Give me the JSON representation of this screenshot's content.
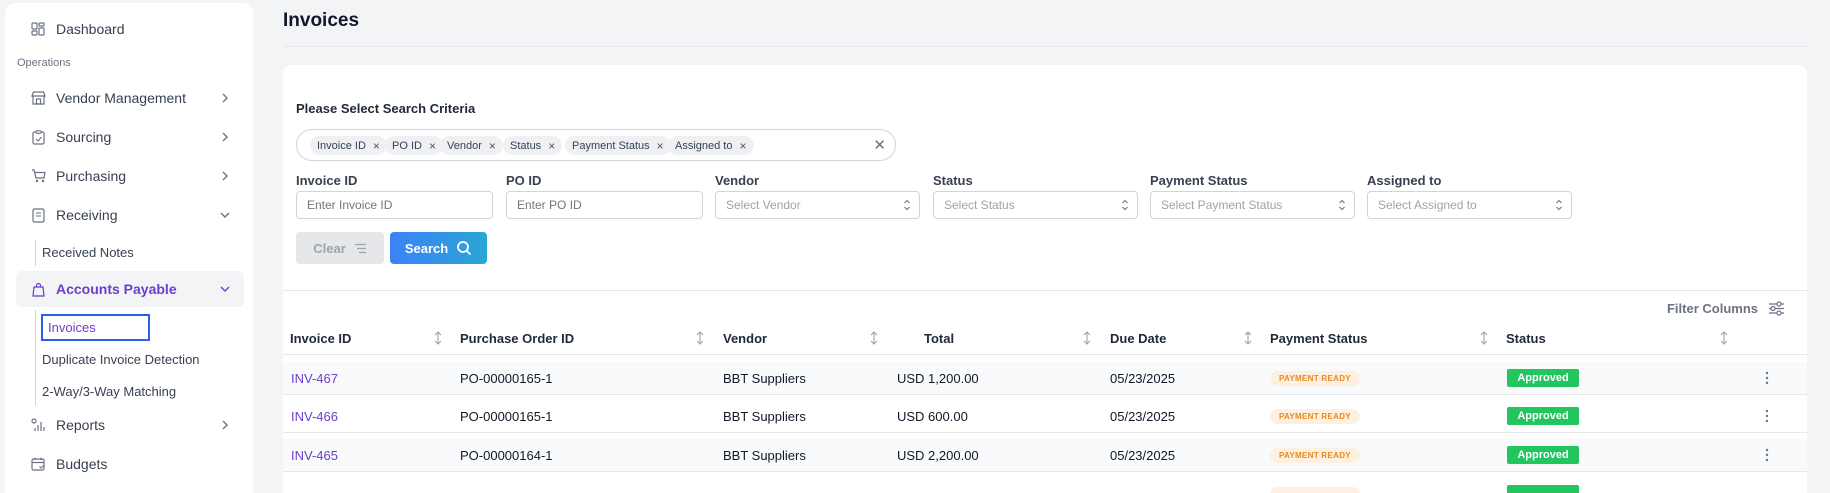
{
  "sidebar": {
    "dashboard": "Dashboard",
    "section_label": "Operations",
    "vendor_management": "Vendor Management",
    "sourcing": "Sourcing",
    "purchasing": "Purchasing",
    "receiving": "Receiving",
    "received_notes": "Received Notes",
    "accounts_payable": "Accounts Payable",
    "invoices": "Invoices",
    "duplicate_detection": "Duplicate Invoice Detection",
    "matching": "2-Way/3-Way Matching",
    "reports": "Reports",
    "budgets": "Budgets"
  },
  "page": {
    "title": "Invoices"
  },
  "search": {
    "title": "Please Select Search Criteria",
    "chips": [
      "Invoice ID",
      "PO ID",
      "Vendor",
      "Status",
      "Payment Status",
      "Assigned to"
    ],
    "fields": {
      "invoice_id": {
        "label": "Invoice ID",
        "placeholder": "Enter Invoice ID"
      },
      "po_id": {
        "label": "PO ID",
        "placeholder": "Enter PO ID"
      },
      "vendor": {
        "label": "Vendor",
        "placeholder": "Select Vendor"
      },
      "status": {
        "label": "Status",
        "placeholder": "Select Status"
      },
      "payment_status": {
        "label": "Payment Status",
        "placeholder": "Select Payment Status"
      },
      "assigned_to": {
        "label": "Assigned to",
        "placeholder": "Select Assigned to"
      }
    },
    "clear_label": "Clear",
    "search_label": "Search"
  },
  "table": {
    "filter_columns": "Filter Columns",
    "headers": [
      "Invoice ID",
      "Purchase Order ID",
      "Vendor",
      "Total",
      "Due Date",
      "Payment Status",
      "Status"
    ],
    "rows": [
      {
        "invoice_id": "INV-467",
        "po_id": "PO-00000165-1",
        "vendor": "BBT Suppliers",
        "total": "USD 1,200.00",
        "due_date": "05/23/2025",
        "payment_status": "PAYMENT READY",
        "status": "Approved"
      },
      {
        "invoice_id": "INV-466",
        "po_id": "PO-00000165-1",
        "vendor": "BBT Suppliers",
        "total": "USD 600.00",
        "due_date": "05/23/2025",
        "payment_status": "PAYMENT READY",
        "status": "Approved"
      },
      {
        "invoice_id": "INV-465",
        "po_id": "PO-00000164-1",
        "vendor": "BBT Suppliers",
        "total": "USD 2,200.00",
        "due_date": "05/23/2025",
        "payment_status": "PAYMENT READY",
        "status": "Approved"
      }
    ]
  },
  "colors": {
    "accent": "#6b3fc9",
    "search_button": "#3b82f6",
    "approved": "#22c55e",
    "payment_ready_text": "#e58a1f"
  }
}
